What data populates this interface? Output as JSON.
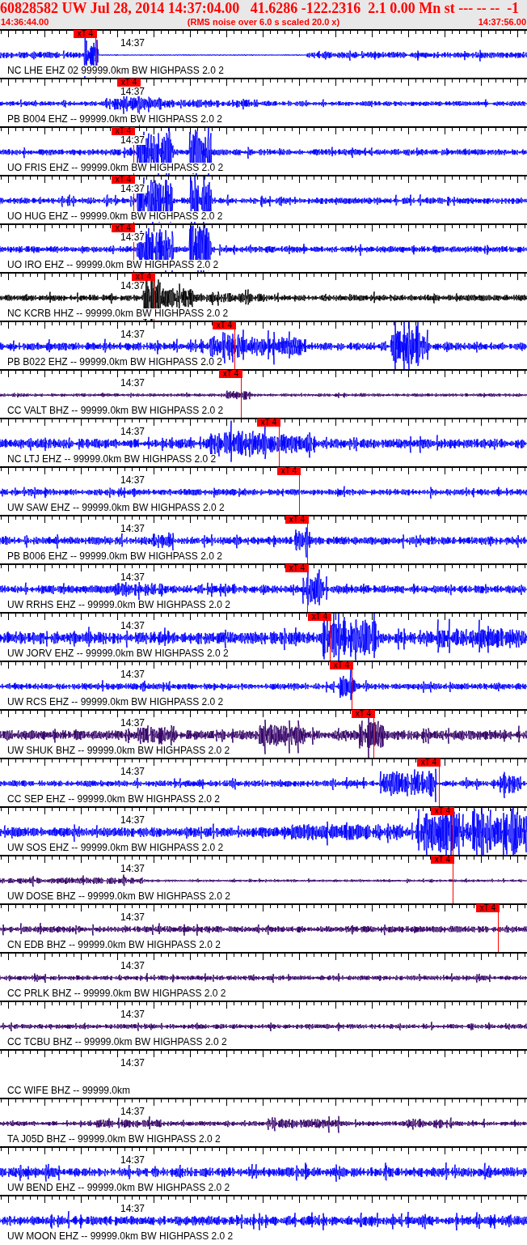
{
  "header": {
    "title": "60828582 UW Jul 28, 2014 14:37:04.00   41.6286 -122.2316  2.1 0.00 Mn st --- -- --  -1",
    "start_time": "14:36:44.00",
    "note": "(RMS noise over 6.0 s scaled 20.0 x)",
    "end_time": "14:37:56.00"
  },
  "traces": [
    {
      "time_label": "14:37",
      "station": "NC LHE EHZ 02 99999.0km BW HIGHPASS 2.0 2",
      "color": "#0000ff",
      "pick": "xT 4"
    },
    {
      "time_label": "14:37",
      "station": "PB B004 EHZ -- 99999.0km BW HIGHPASS 2.0 2",
      "color": "#0000ff",
      "pick": "xT 4"
    },
    {
      "time_label": "14:37",
      "station": "UO FRIS EHZ -- 99999.0km BW HIGHPASS 2.0 2",
      "color": "#0000ff",
      "pick": "xT 4"
    },
    {
      "time_label": "14:37",
      "station": "UO HUG EHZ -- 99999.0km BW HIGHPASS 2.0 2",
      "color": "#0000ff",
      "pick": "xT 4"
    },
    {
      "time_label": "14:37",
      "station": "UO IRO EHZ -- 99999.0km BW HIGHPASS 2.0 2",
      "color": "#0000ff",
      "pick": "xT 4"
    },
    {
      "time_label": "14:37",
      "station": "NC KCRB HHZ -- 99999.0km BW HIGHPASS 2.0 2",
      "color": "#000000",
      "pick": "xT 4"
    },
    {
      "time_label": "14:37",
      "station": "PB B022 EHZ -- 99999.0km BW HIGHPASS 2.0 2",
      "color": "#0000ff",
      "pick": "xT 4"
    },
    {
      "time_label": "14:37",
      "station": "CC VALT BHZ -- 99999.0km BW HIGHPASS 2.0 2",
      "color": "#330066",
      "pick": "xT 4"
    },
    {
      "time_label": "14:37",
      "station": "NC LTJ EHZ -- 99999.0km BW HIGHPASS 2.0 2",
      "color": "#0000ff",
      "pick": "xT 4"
    },
    {
      "time_label": "14:37",
      "station": "UW SAW EHZ -- 99999.0km BW HIGHPASS 2.0 2",
      "color": "#0000ff",
      "pick": "xT 4"
    },
    {
      "time_label": "14:37",
      "station": "PB B006 EHZ -- 99999.0km BW HIGHPASS 2.0 2",
      "color": "#0000ff",
      "pick": "xT 4"
    },
    {
      "time_label": "14:37",
      "station": "UW RRHS EHZ -- 99999.0km BW HIGHPASS 2.0 2",
      "color": "#0000ff",
      "pick": "xT 4"
    },
    {
      "time_label": "14:37",
      "station": "UW JORV EHZ -- 99999.0km BW HIGHPASS 2.0 2",
      "color": "#0000ff",
      "pick": "xT 4"
    },
    {
      "time_label": "14:37",
      "station": "UW RCS EHZ -- 99999.0km BW HIGHPASS 2.0 2",
      "color": "#0000ff",
      "pick": "xT 4"
    },
    {
      "time_label": "14:37",
      "station": "UW SHUK BHZ -- 99999.0km BW HIGHPASS 2.0 2",
      "color": "#330066",
      "pick": "xT 4"
    },
    {
      "time_label": "14:37",
      "station": "CC SEP EHZ -- 99999.0km BW HIGHPASS 2.0 2",
      "color": "#0000ff",
      "pick": "xT 4"
    },
    {
      "time_label": "14:37",
      "station": "UW SOS EHZ -- 99999.0km BW HIGHPASS 2.0 2",
      "color": "#0000ff",
      "pick": "xT 4"
    },
    {
      "time_label": "14:37",
      "station": "UW DOSE BHZ -- 99999.0km BW HIGHPASS 2.0 2",
      "color": "#330066",
      "pick": "xT 4"
    },
    {
      "time_label": "14:37",
      "station": "CN EDB BHZ -- 99999.0km BW HIGHPASS 2.0 2",
      "color": "#330066",
      "pick": "xT 4"
    },
    {
      "time_label": "14:37",
      "station": "CC PRLK BHZ -- 99999.0km BW HIGHPASS 2.0 2",
      "color": "#330066"
    },
    {
      "time_label": "14:37",
      "station": "CC TCBU BHZ -- 99999.0km BW HIGHPASS 2.0 2",
      "color": "#330066"
    },
    {
      "time_label": "14:37",
      "station": "CC WIFE BHZ -- 99999.0km"
    },
    {
      "time_label": "14:37",
      "station": "TA J05D BHZ -- 99999.0km BW HIGHPASS 2.0 2",
      "color": "#330066"
    },
    {
      "time_label": "14:37",
      "station": "UW BEND EHZ -- 99999.0km BW HIGHPASS 2.0 2",
      "color": "#0000ff"
    },
    {
      "time_label": "14:37",
      "station": "UW MOON EHZ -- 99999.0km BW HIGHPASS 2.0 2",
      "color": "#0000ff"
    }
  ]
}
